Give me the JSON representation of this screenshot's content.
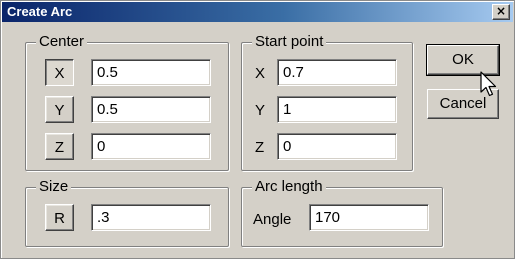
{
  "window": {
    "title": "Create Arc",
    "close_label": "×"
  },
  "center": {
    "label": "Center",
    "rows": [
      {
        "button": "X",
        "value": "0.5"
      },
      {
        "button": "Y",
        "value": "0.5"
      },
      {
        "button": "Z",
        "value": "0"
      }
    ]
  },
  "start_point": {
    "label": "Start point",
    "rows": [
      {
        "axis": "X",
        "value": "0.7"
      },
      {
        "axis": "Y",
        "value": "1"
      },
      {
        "axis": "Z",
        "value": "0"
      }
    ]
  },
  "size": {
    "label": "Size",
    "button": "R",
    "value": ".3"
  },
  "arc_length": {
    "label": "Arc length",
    "angle_label": "Angle",
    "angle_value": "170"
  },
  "buttons": {
    "ok": "OK",
    "cancel": "Cancel"
  }
}
